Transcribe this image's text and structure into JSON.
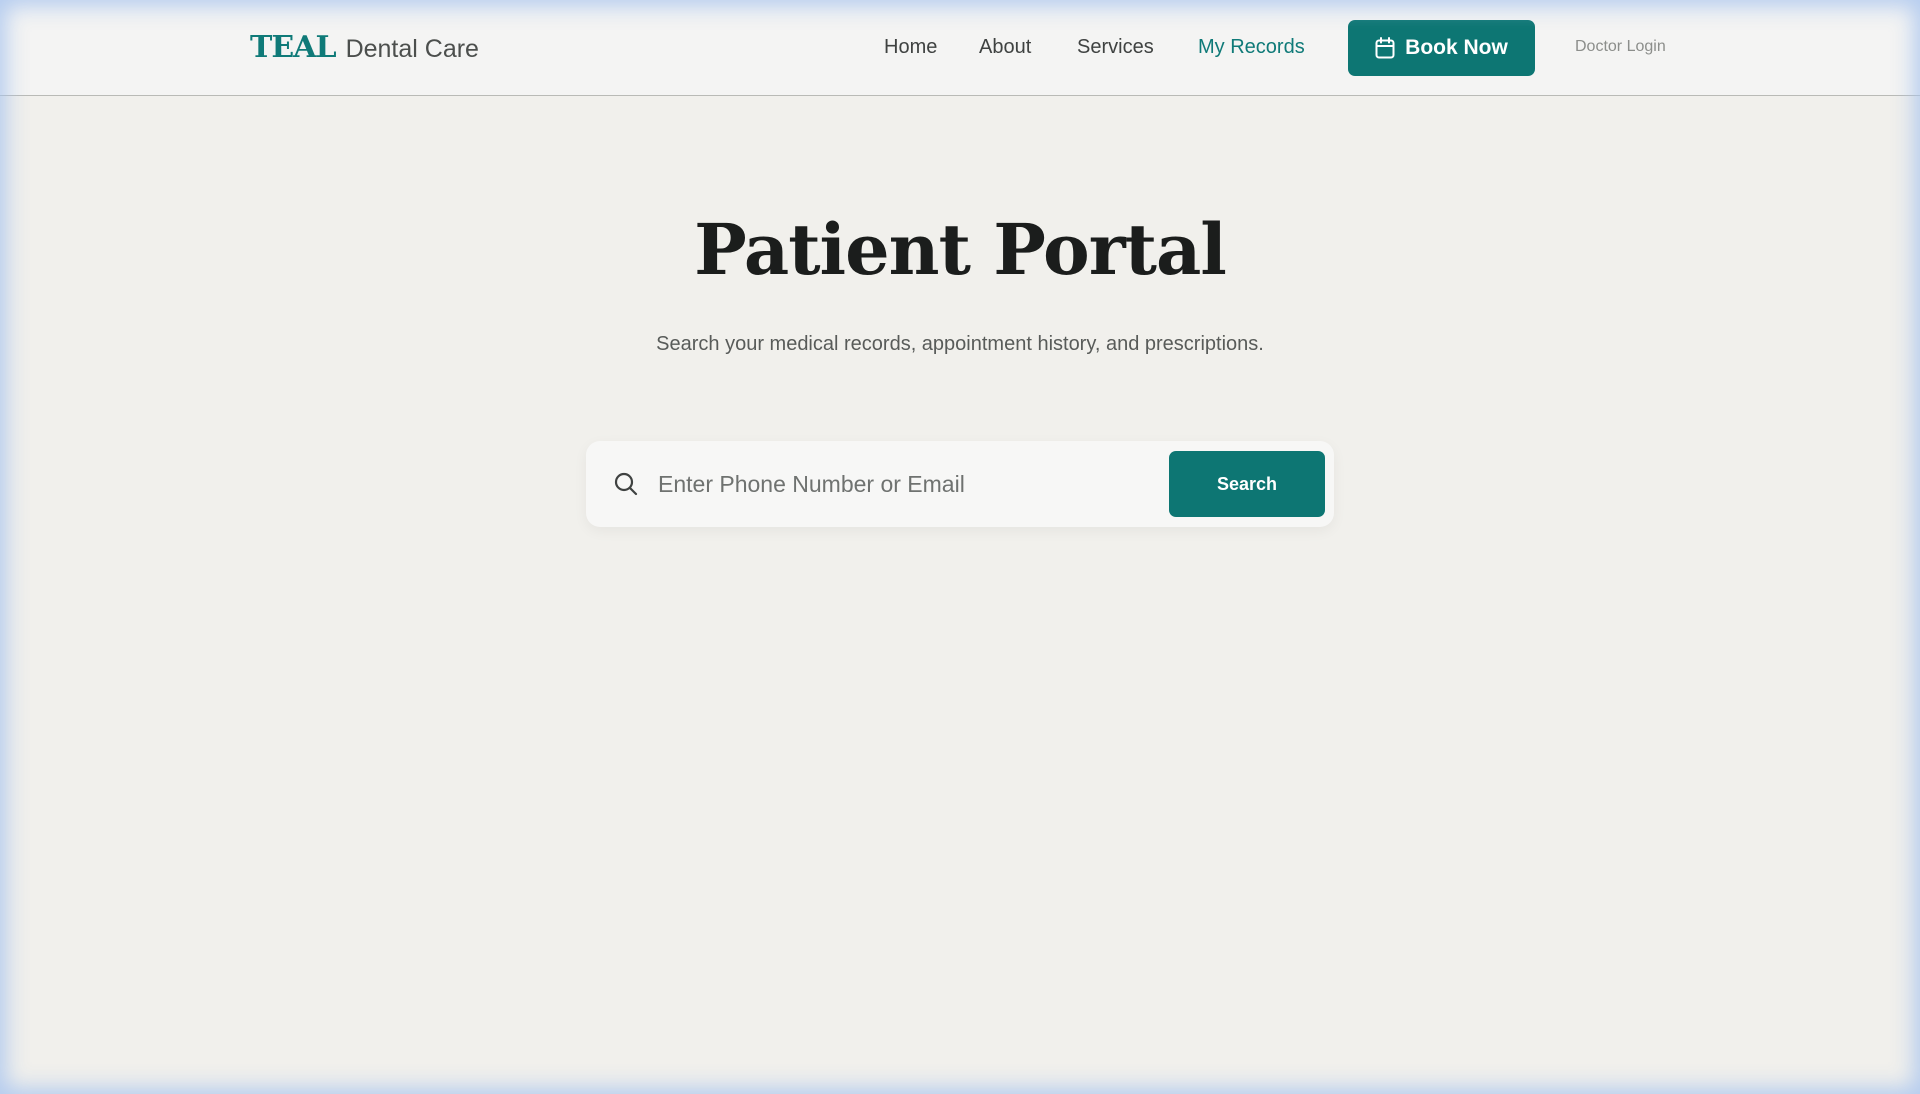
{
  "header": {
    "brand_mark": "TEAL",
    "brand_name": "Dental Care",
    "nav": [
      {
        "label": "Home",
        "active": false
      },
      {
        "label": "About",
        "active": false
      },
      {
        "label": "Services",
        "active": false
      },
      {
        "label": "My Records",
        "active": true
      }
    ],
    "book_button": {
      "label": "Book Now",
      "icon": "calendar-icon"
    },
    "doctor_login": "Doctor Login"
  },
  "hero": {
    "title": "Patient Portal",
    "subtitle": "Search your medical records, appointment history, and prescriptions."
  },
  "search": {
    "icon": "search-icon",
    "placeholder": "Enter Phone Number or Email",
    "value": "",
    "button_label": "Search"
  },
  "colors": {
    "accent": "#0d7673",
    "background": "#f1f0ec",
    "header_bg": "#f4f4f3"
  }
}
